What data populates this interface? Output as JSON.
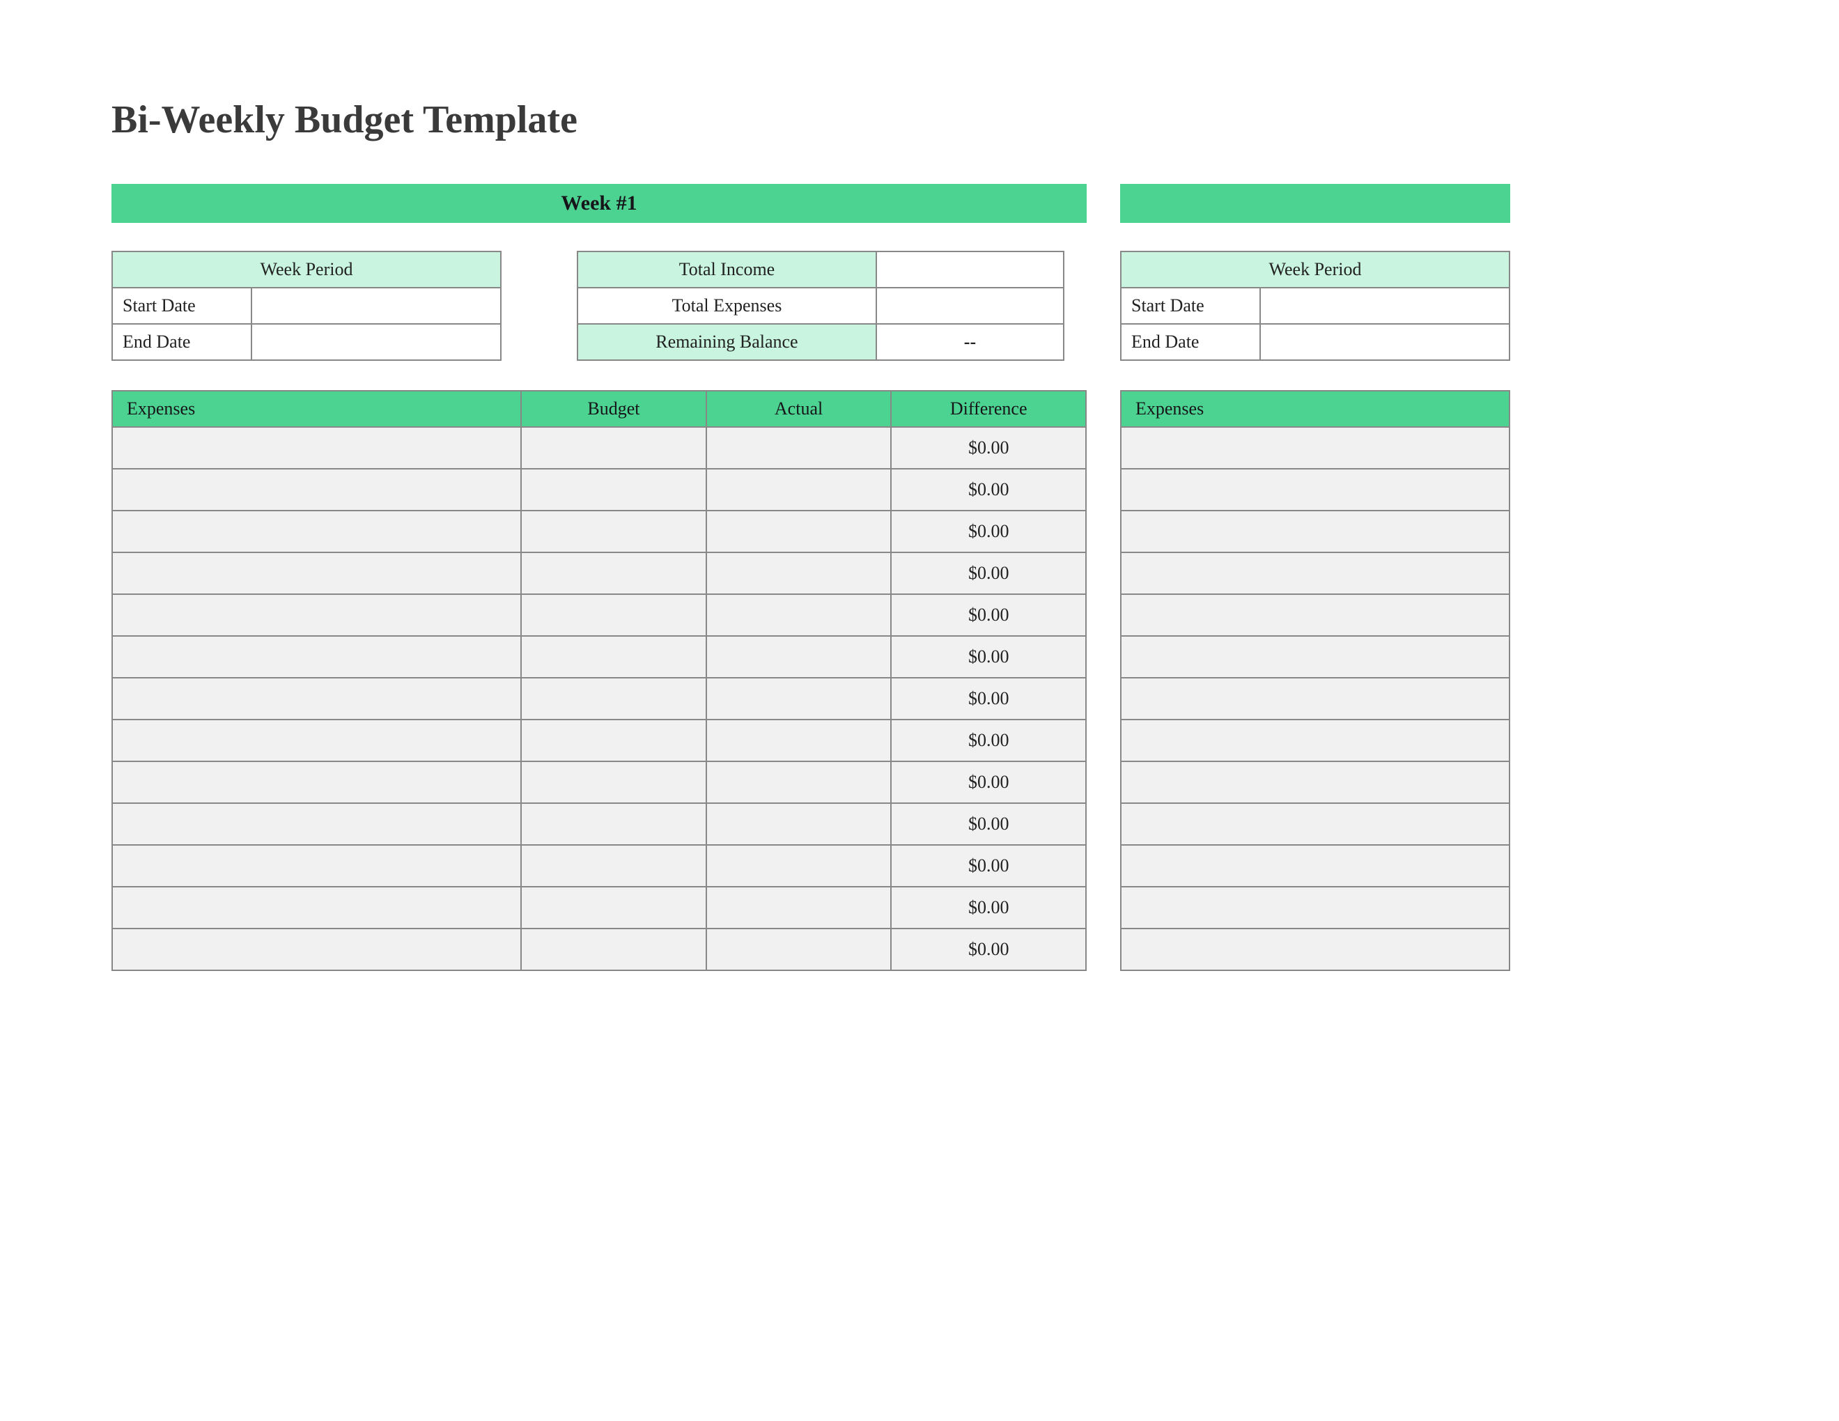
{
  "title": "Bi-Weekly Budget Template",
  "week1": {
    "banner": "Week #1",
    "period": {
      "header": "Week Period",
      "start_label": "Start Date",
      "start_value": "",
      "end_label": "End Date",
      "end_value": ""
    },
    "totals": {
      "income_label": "Total Income",
      "income_value": "",
      "expenses_label": "Total Expenses",
      "expenses_value": "",
      "balance_label": "Remaining Balance",
      "balance_value": "--"
    },
    "table": {
      "headers": {
        "expenses": "Expenses",
        "budget": "Budget",
        "actual": "Actual",
        "difference": "Difference"
      },
      "rows": [
        {
          "expenses": "",
          "budget": "",
          "actual": "",
          "difference": "$0.00"
        },
        {
          "expenses": "",
          "budget": "",
          "actual": "",
          "difference": "$0.00"
        },
        {
          "expenses": "",
          "budget": "",
          "actual": "",
          "difference": "$0.00"
        },
        {
          "expenses": "",
          "budget": "",
          "actual": "",
          "difference": "$0.00"
        },
        {
          "expenses": "",
          "budget": "",
          "actual": "",
          "difference": "$0.00"
        },
        {
          "expenses": "",
          "budget": "",
          "actual": "",
          "difference": "$0.00"
        },
        {
          "expenses": "",
          "budget": "",
          "actual": "",
          "difference": "$0.00"
        },
        {
          "expenses": "",
          "budget": "",
          "actual": "",
          "difference": "$0.00"
        },
        {
          "expenses": "",
          "budget": "",
          "actual": "",
          "difference": "$0.00"
        },
        {
          "expenses": "",
          "budget": "",
          "actual": "",
          "difference": "$0.00"
        },
        {
          "expenses": "",
          "budget": "",
          "actual": "",
          "difference": "$0.00"
        },
        {
          "expenses": "",
          "budget": "",
          "actual": "",
          "difference": "$0.00"
        },
        {
          "expenses": "",
          "budget": "",
          "actual": "",
          "difference": "$0.00"
        }
      ]
    }
  },
  "week2": {
    "banner": "",
    "period": {
      "header": "Week Period",
      "start_label": "Start Date",
      "start_value": "",
      "end_label": "End Date",
      "end_value": ""
    },
    "table": {
      "headers": {
        "expenses": "Expenses"
      },
      "rows": [
        {
          "expenses": ""
        },
        {
          "expenses": ""
        },
        {
          "expenses": ""
        },
        {
          "expenses": ""
        },
        {
          "expenses": ""
        },
        {
          "expenses": ""
        },
        {
          "expenses": ""
        },
        {
          "expenses": ""
        },
        {
          "expenses": ""
        },
        {
          "expenses": ""
        },
        {
          "expenses": ""
        },
        {
          "expenses": ""
        },
        {
          "expenses": ""
        }
      ]
    }
  }
}
